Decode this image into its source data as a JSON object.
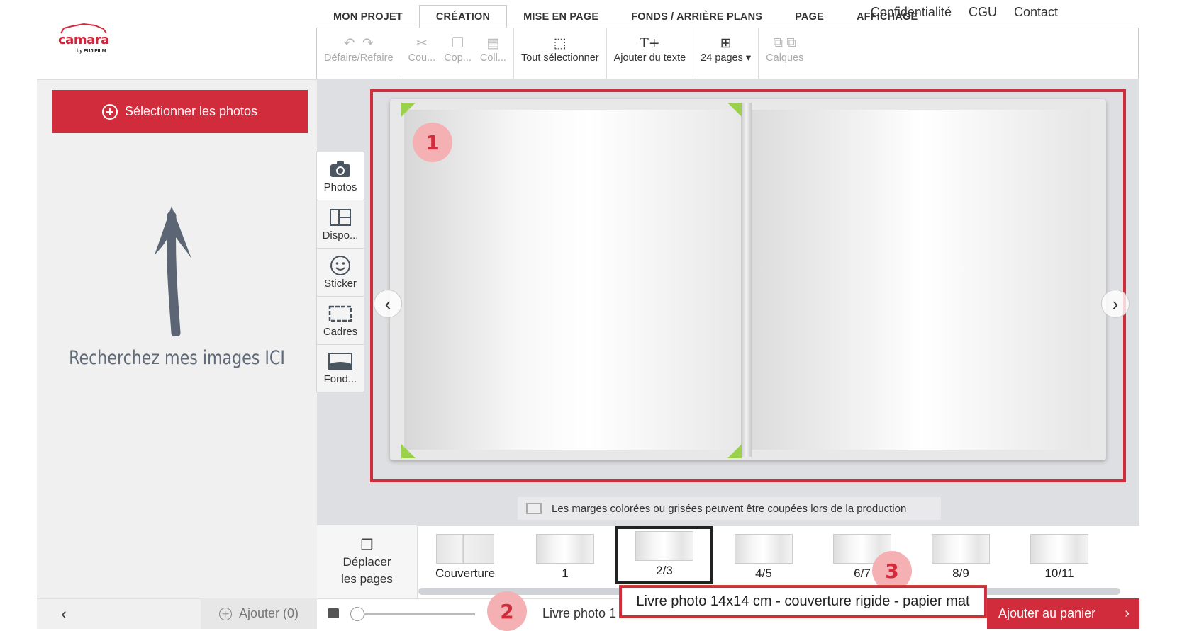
{
  "brand": {
    "name": "camara",
    "byline": "by FUJIFILM"
  },
  "tabs": [
    "MON PROJET",
    "CRÉATION",
    "MISE EN PAGE",
    "FONDS / ARRIÈRE PLANS",
    "PAGE",
    "AFFICHAGE"
  ],
  "active_tab": "CRÉATION",
  "top_links": [
    "Confidentialité",
    "CGU",
    "Contact"
  ],
  "toolbar": {
    "undo_redo": "Défaire/Refaire",
    "cut": "Cou...",
    "copy": "Cop...",
    "paste": "Coll...",
    "select_all": "Tout sélectionner",
    "add_text": "Ajouter du texte",
    "pages": "24 pages",
    "layers": "Calques"
  },
  "left_panel": {
    "select_photos": "Sélectionner les photos",
    "hint": "Recherchez mes images ICI",
    "add_label": "Ajouter (0)"
  },
  "side_tools": [
    "Photos",
    "Dispo...",
    "Sticker",
    "Cadres",
    "Fond..."
  ],
  "margin_note": "Les marges colorées ou grisées peuvent être coupées lors de la production",
  "move_pages": [
    "Déplacer",
    "les pages"
  ],
  "thumbnails": [
    "Couverture",
    "1",
    "2/3",
    "4/5",
    "6/7",
    "8/9",
    "10/11"
  ],
  "selected_thumbnail": "2/3",
  "tooltip": "Livre photo 14x14 cm - couverture rigide - papier mat",
  "product_label": "Livre photo 1",
  "cart_button": "Ajouter au panier",
  "markers": [
    "1",
    "2",
    "3"
  ],
  "colors": {
    "accent": "#d12c3c",
    "marker_bg": "#f4b0b3",
    "canvas_bg": "#dedfe2",
    "corner_green": "#9ad14b"
  }
}
